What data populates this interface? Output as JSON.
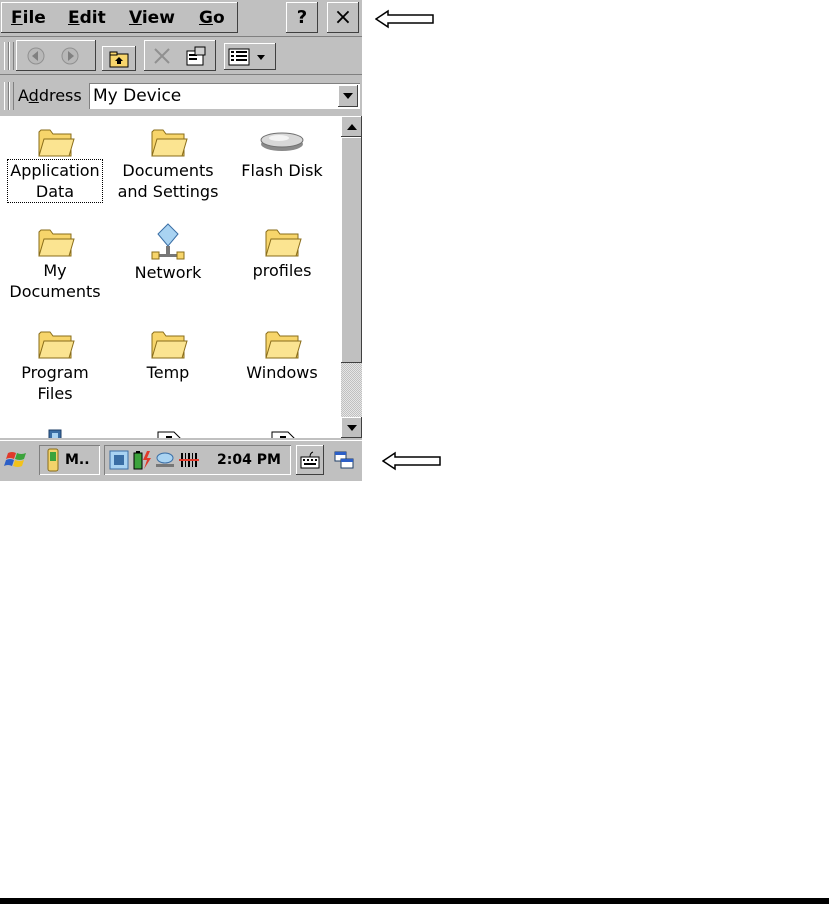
{
  "menu": {
    "items": [
      {
        "label": "File",
        "mnemonic": "F",
        "rest": "ile"
      },
      {
        "label": "Edit",
        "mnemonic": "E",
        "rest": "dit"
      },
      {
        "label": "View",
        "mnemonic": "V",
        "rest": "iew"
      },
      {
        "label": "Go",
        "mnemonic": "G",
        "rest": "o"
      }
    ],
    "help_label": "?",
    "close_label": "×"
  },
  "toolbar": {
    "icons": [
      "back-arrow-icon",
      "forward-arrow-icon",
      "up-folder-icon",
      "delete-icon",
      "properties-icon",
      "view-details-icon"
    ]
  },
  "address": {
    "label_prefix": "A",
    "label_mnemonic": "d",
    "label_suffix": "dress",
    "value": "My Device"
  },
  "files": [
    {
      "line1": "Application",
      "line2": "Data",
      "icon": "folder-icon",
      "focused": true
    },
    {
      "line1": "Documents",
      "line2": "and Settings",
      "icon": "folder-icon",
      "focused": false
    },
    {
      "line1": "Flash Disk",
      "line2": "",
      "icon": "flash-disk-icon",
      "focused": false
    },
    {
      "line1": "My",
      "line2": "Documents",
      "icon": "folder-icon",
      "focused": false
    },
    {
      "line1": "Network",
      "line2": "",
      "icon": "network-icon",
      "focused": false
    },
    {
      "line1": "profiles",
      "line2": "",
      "icon": "folder-icon",
      "focused": false
    },
    {
      "line1": "Program Files",
      "line2": "",
      "icon": "folder-icon",
      "focused": false
    },
    {
      "line1": "Temp",
      "line2": "",
      "icon": "folder-icon",
      "focused": false
    },
    {
      "line1": "Windows",
      "line2": "",
      "icon": "folder-icon",
      "focused": false
    },
    {
      "line1": "",
      "line2": "",
      "icon": "app-shortcut-icon",
      "focused": false
    },
    {
      "line1": "",
      "line2": "",
      "icon": "document-icon",
      "focused": false
    },
    {
      "line1": "",
      "line2": "",
      "icon": "document-icon",
      "focused": false
    }
  ],
  "taskbar": {
    "start_icon": "windows-flag-icon",
    "task_label": "M..",
    "clock": "2:04 PM",
    "tray_icons": [
      "connection-icon",
      "battery-icon",
      "network-tray-icon",
      "barcode-icon"
    ],
    "keyboard_icon": "keyboard-icon",
    "desktop_icon": "show-desktop-icon"
  },
  "colors": {
    "chrome": "#c0c0c0",
    "folder": "#f7d56b",
    "folder_outline": "#8a6d1a"
  }
}
